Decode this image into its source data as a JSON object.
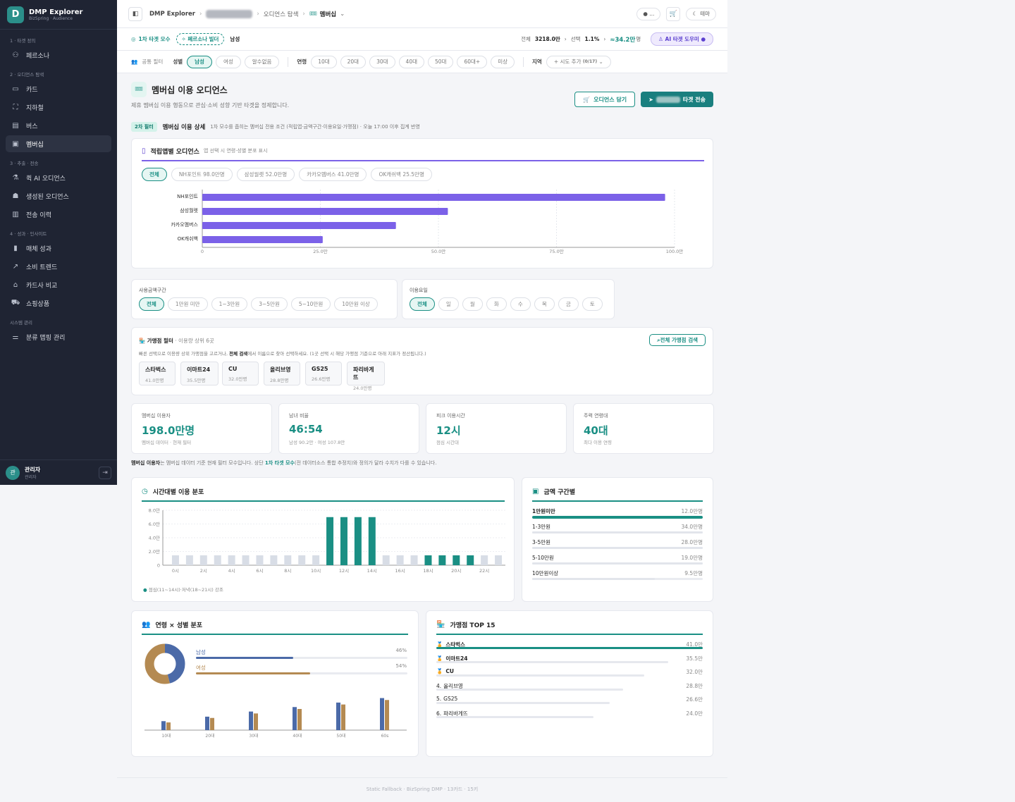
{
  "sidebar": {
    "brand_title": "DMP Explorer",
    "brand_sub": "BizSpring · Audience",
    "logo_letter": "D",
    "sections": [
      {
        "label": "1 · 타겟 정의",
        "items": [
          {
            "label": "페르소나",
            "icon": "persona-icon"
          }
        ]
      },
      {
        "label": "2 · 오디언스 탐색",
        "items": [
          {
            "label": "카드",
            "icon": "card-icon"
          },
          {
            "label": "지하철",
            "icon": "subway-icon"
          },
          {
            "label": "버스",
            "icon": "bus-icon"
          },
          {
            "label": "멤버십",
            "icon": "membership-icon",
            "active": true
          }
        ]
      },
      {
        "label": "3 · 추출 · 전송",
        "items": [
          {
            "label": "퀵 AI 오디언스",
            "icon": "flask-icon"
          },
          {
            "label": "생성된 오디언스",
            "icon": "cubes-icon"
          },
          {
            "label": "전송 이력",
            "icon": "clipboard-icon"
          }
        ]
      },
      {
        "label": "4 · 성과 · 인사이트",
        "items": [
          {
            "label": "매체 성과",
            "icon": "bar-chart-icon"
          },
          {
            "label": "소비 트렌드",
            "icon": "trend-icon"
          },
          {
            "label": "카드사 비교",
            "icon": "bank-icon"
          },
          {
            "label": "쇼핑상품",
            "icon": "cart-icon"
          }
        ]
      },
      {
        "label": "시스템 관리",
        "items": [
          {
            "label": "분류 맵핑 관리",
            "icon": "mapping-icon"
          }
        ]
      }
    ],
    "user": {
      "avatar": "관",
      "name": "관리자",
      "role": "관리자"
    }
  },
  "topbar": {
    "crumb1": "DMP Explorer",
    "crumb3": "오디언스 탐색",
    "crumb4": "멤버십",
    "pill": "● ...",
    "theme": "테마"
  },
  "targetbar": {
    "label": "1차 타겟 모수",
    "persona_btn": "페르소나 빌더",
    "gender": "남성",
    "total_label": "전체",
    "total": "3218.0만",
    "sel_label": "선택",
    "sel": "1.1%",
    "approx": "≈34.2만",
    "approx_unit": "명",
    "ai": "AI 타겟 도우미"
  },
  "filters": {
    "common": "공통 필터",
    "gender_label": "성별",
    "genders": [
      "남성",
      "여성",
      "알수없음"
    ],
    "age_label": "연령",
    "ages": [
      "10대",
      "20대",
      "30대",
      "40대",
      "50대",
      "60대+",
      "미상"
    ],
    "region_label": "지역",
    "region_btn": "+ 시도 추가",
    "region_count": "(0/17)"
  },
  "page": {
    "title": "멤버십 이용 오디언스",
    "sub": "제휴 멤버십 이용 행동으로 관심·소비 성향 기반 타겟을 정제합니다.",
    "save_btn": "오디언스 담기",
    "send_btn": "타겟 전송"
  },
  "filter2": {
    "tag": "2차 필터",
    "title": "멤버십 이용 상세",
    "desc": "1차 모수를 좁히는 멤버십 전용 조건 (적립앱·금액구간·이용요일·가맹점) · 오늘 17:00 이후 집계 반영"
  },
  "appcard": {
    "title": "적립앱별 오디언스",
    "sub": "앱 선택 시 연령·성별 분포 표시",
    "chips": [
      "전체",
      "NH포인트 98.0만명",
      "삼성월렛 52.0만명",
      "카카오멤버스 41.0만명",
      "OK캐쉬백 25.5만명"
    ]
  },
  "amountfilter": {
    "title": "사용금액구간",
    "chips": [
      "전체",
      "1만원 미만",
      "1~3만원",
      "3~5만원",
      "5~10만원",
      "10만원 이상"
    ]
  },
  "dayfilter": {
    "title": "이용요일",
    "chips": [
      "전체",
      "일",
      "월",
      "화",
      "수",
      "목",
      "금",
      "토"
    ]
  },
  "storefilter": {
    "title": "가맹점 필터",
    "title_sub": "· 이용량 상위 6곳",
    "desc_a": "빠른 선택으로 이용량 상위 가맹점을 고르거나,",
    "desc_b": "전체 검색",
    "desc_c": "에서 이름으로 찾아 선택하세요. (1곳 선택 시 해당 가맹점 기준으로 아래 지표가 정산됩니다.)",
    "search_btn": "전체 가맹점 검색",
    "stores": [
      {
        "name": "스타벅스",
        "count": "41.0만명"
      },
      {
        "name": "이마트24",
        "count": "35.5만명"
      },
      {
        "name": "CU",
        "count": "32.0만명"
      },
      {
        "name": "올리브영",
        "count": "28.8만명"
      },
      {
        "name": "GS25",
        "count": "26.6만명"
      },
      {
        "name": "파리바게뜨",
        "count": "24.0만명"
      }
    ]
  },
  "kpis": [
    {
      "label": "멤버십 이용자",
      "value": "198.0만명",
      "desc": "멤버십 데이터 · 현재 필터"
    },
    {
      "label": "남녀 비율",
      "value": "46:54",
      "desc": "남성 90.2만 · 여성 107.8만"
    },
    {
      "label": "피크 이용시간",
      "value": "12시",
      "desc": "점심 시간대"
    },
    {
      "label": "주력 연령대",
      "value": "40대",
      "desc": "최다 이용 연령"
    }
  ],
  "note": {
    "b1": "멤버십 이용자",
    "t1": "는 멤버십 데이터 기준 현재 필터 모수입니다. 상단",
    "b2": "1차 타겟 모수",
    "t2": "(전 데이터소스 통합 추정치)와 정의가 달라 수치가 다를 수 있습니다."
  },
  "hourcard": {
    "title": "시간대별 이용 분포",
    "legend": "점심(11~14시)·저녁(18~21시) 강조"
  },
  "amountcard": {
    "title": "금액 구간별",
    "rows": [
      {
        "label": "1만원미만",
        "value": "12.0만명",
        "pct": 1.0
      },
      {
        "label": "1-3만원",
        "value": "34.0만명",
        "pct": 1.0
      },
      {
        "label": "3-5만원",
        "value": "28.0만명",
        "pct": 1.0
      },
      {
        "label": "5-10만원",
        "value": "19.0만명",
        "pct": 1.0
      },
      {
        "label": "10만원이상",
        "value": "9.5만명",
        "pct": 0.72
      }
    ]
  },
  "agecard": {
    "title": "연령 × 성별 분포",
    "male": "남성",
    "female": "여성",
    "male_pct": "46%",
    "female_pct": "54%"
  },
  "topcard": {
    "title": "가맹점 TOP 15",
    "rows": [
      {
        "rank": "1",
        "name": "스타벅스",
        "value": "41.0만",
        "pct": 1.0
      },
      {
        "rank": "2",
        "name": "이마트24",
        "value": "35.5만",
        "pct": 0.87
      },
      {
        "rank": "3",
        "name": "CU",
        "value": "32.0만",
        "pct": 0.78
      },
      {
        "rank": "4.",
        "name": "올리브영",
        "value": "28.8만",
        "pct": 0.7
      },
      {
        "rank": "5.",
        "name": "GS25",
        "value": "26.6만",
        "pct": 0.65
      },
      {
        "rank": "6.",
        "name": "파리바게뜨",
        "value": "24.0만",
        "pct": 0.59
      }
    ]
  },
  "footer": "Static Fallback · BizSpring DMP · 13카드 · 15키",
  "colors": {
    "teal": "#1a8f84",
    "purple": "#7b61e8",
    "male": "#4b6aa8",
    "female": "#b48a52",
    "gray": "#d8dde6"
  },
  "chart_data": [
    {
      "type": "bar",
      "orientation": "horizontal",
      "categories": [
        "NH포인트",
        "삼성월렛",
        "카카오멤버스",
        "OK캐쉬백"
      ],
      "values": [
        98.0,
        52.0,
        41.0,
        25.5
      ],
      "xlim": [
        0,
        100
      ],
      "ticks": [
        "0",
        "25.0만",
        "50.0만",
        "75.0만",
        "100.0만"
      ]
    },
    {
      "type": "bar",
      "categories": [
        "0시",
        "1시",
        "2시",
        "3시",
        "4시",
        "5시",
        "6시",
        "7시",
        "8시",
        "9시",
        "10시",
        "11시",
        "12시",
        "13시",
        "14시",
        "15시",
        "16시",
        "17시",
        "18시",
        "19시",
        "20시",
        "21시",
        "22시",
        "23시"
      ],
      "x_labels": [
        "0시",
        "",
        "2시",
        "",
        "4시",
        "",
        "6시",
        "",
        "8시",
        "",
        "10시",
        "",
        "12시",
        "",
        "14시",
        "",
        "16시",
        "",
        "18시",
        "",
        "20시",
        "",
        "22시",
        ""
      ],
      "values": [
        0.8,
        0.8,
        0.8,
        0.8,
        0.8,
        0.8,
        0.8,
        0.8,
        0.8,
        0.8,
        0.8,
        7.0,
        7.0,
        7.0,
        7.0,
        0.8,
        0.8,
        0.8,
        0.8,
        0.8,
        0.8,
        0.8,
        0.8,
        0.8
      ],
      "highlight": [
        11,
        12,
        13,
        14,
        18,
        19,
        20,
        21
      ],
      "ylim": [
        0,
        8
      ],
      "yticks": [
        "0",
        "2.0만",
        "4.0만",
        "6.0만",
        "8.0만"
      ]
    },
    {
      "type": "pie",
      "categories": [
        "남성",
        "여성"
      ],
      "values": [
        46,
        54
      ]
    },
    {
      "type": "bar",
      "categories": [
        "10대",
        "20대",
        "30대",
        "40대",
        "50대",
        "60s"
      ],
      "series": [
        {
          "name": "남성",
          "values": [
            14,
            21,
            29,
            36,
            43,
            50
          ]
        },
        {
          "name": "여성",
          "values": [
            12,
            19,
            26,
            33,
            40,
            47
          ]
        }
      ],
      "ylim": [
        0,
        55
      ]
    }
  ]
}
